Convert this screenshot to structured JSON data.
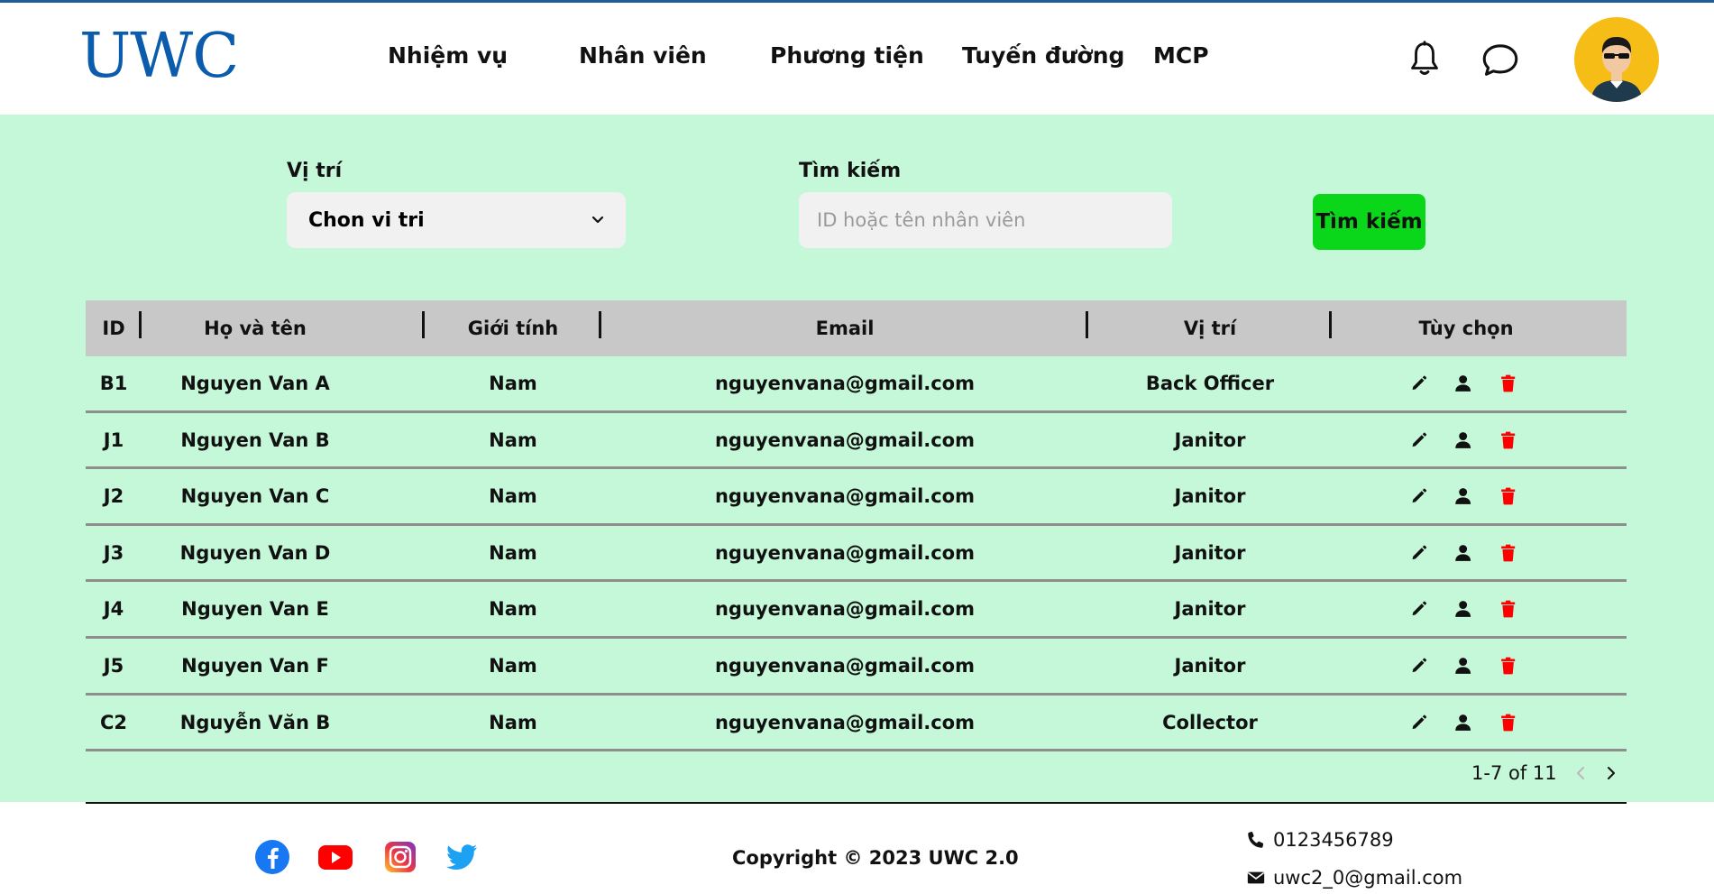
{
  "header": {
    "logo": "UWC",
    "nav": [
      "Nhiệm vụ",
      "Nhân viên",
      "Phương tiện",
      "Tuyến đường",
      "MCP"
    ]
  },
  "filters": {
    "position_label": "Vị trí",
    "position_selected": "Chon vi tri",
    "search_label": "Tìm kiếm",
    "search_placeholder": "ID hoặc tên nhân viên",
    "search_button": "Tìm kiếm"
  },
  "table": {
    "headers": [
      "ID",
      "Họ và tên",
      "Giới tính",
      "Email",
      "Vị trí",
      "Tùy chọn"
    ],
    "rows": [
      [
        "B1",
        "Nguyen Van A",
        "Nam",
        "nguyenvana@gmail.com",
        "Back Officer"
      ],
      [
        "J1",
        "Nguyen Van B",
        "Nam",
        "nguyenvana@gmail.com",
        "Janitor"
      ],
      [
        "J2",
        "Nguyen Van C",
        "Nam",
        "nguyenvana@gmail.com",
        "Janitor"
      ],
      [
        "J3",
        "Nguyen Van D",
        "Nam",
        "nguyenvana@gmail.com",
        "Janitor"
      ],
      [
        "J4",
        "Nguyen Van E",
        "Nam",
        "nguyenvana@gmail.com",
        "Janitor"
      ],
      [
        "J5",
        "Nguyen Van F",
        "Nam",
        "nguyenvana@gmail.com",
        "Janitor"
      ],
      [
        "C2",
        "Nguyễn Văn B",
        "Nam",
        "nguyenvana@gmail.com",
        "Collector"
      ]
    ],
    "actions": [
      "pencil-icon",
      "user-icon",
      "trash-icon"
    ],
    "pagination": "1-7 of 11"
  },
  "footer": {
    "social": [
      "facebook-icon",
      "youtube-icon",
      "instagram-icon",
      "twitter-icon"
    ],
    "copyright": "Copyright © 2023 UWC 2.0",
    "phone": "0123456789",
    "email": "uwc2_0@gmail.com"
  },
  "colors": {
    "brand": "#0b5cad",
    "background": "#c4f8d9",
    "search_button": "#0ad61a",
    "table_header": "#c8c8c8",
    "delete": "#ff0000",
    "avatar_bg": "#f6bd16"
  }
}
